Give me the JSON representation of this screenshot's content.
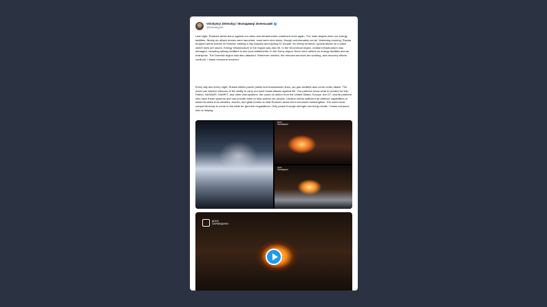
{
  "post": {
    "author_name": "Volodymyr Zelenskyy / Володимир Зеленський",
    "author_handle": "@ZelenskyyUa",
    "paragraph_1": "Last night, Russia's aerial terror against our cities and infrastructure continued once again. The main targets were our energy facilities. Ninety-six attack drones were launched, most were shot down, though unfortunately not all. Yesterday evening, Russia dropped aerial bombs on Kharkiv, striking a city hospital and injuring 57 people. An utterly terminal, cynical attack on a place where lives are saved. Energy infrastructure in the region was also hit. In the Kirovohrad region, civilian infrastructure was damaged, including railway facilities in two local settlements. In the Sumy region, there were strikes on energy facilities and an enterprise. The Donetsk region was also attacked. Wherever needed, the relevant services are working, and recovery efforts continue. I thank everyone involved.",
    "paragraph_2": "Every day and every night, Russia strikes power plants and transmission lines, our gas facilities also come under attack. The world can deprive Moscow of the ability to carry out such brutal attacks against life. Our partners know what is needed for this: Patriot, NASAMS, SAMP/T, and other vital systems. We count on action from the United States, Europe, the G7, and all partners who have these systems and can provide them to help protect our people. Ukraine needs sufficient air defense capabilities to shield its skies from missiles, drones, and glide bombs so that Russia's aerial terror becomes meaningless. The world must compel Moscow to come to the table for genuine negotiations. Only peace through strength can bring results. I thank everyone who is helping.",
    "photo_watermark": "ДСНС\nХАРКІВЩИНИ",
    "video_watermark": "ДСНС\nХАРКІВЩИНИ"
  },
  "icons": {
    "verified": "verified-badge-icon",
    "play": "play-icon",
    "logo": "dsns-logo-icon"
  },
  "colors": {
    "background": "#2b3343",
    "card": "#ffffff",
    "accent": "#1d9bf0"
  }
}
